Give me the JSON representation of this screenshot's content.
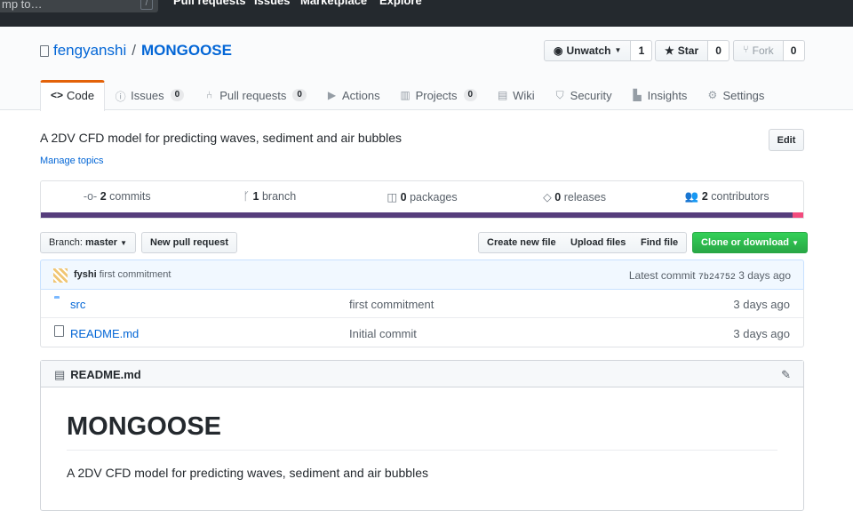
{
  "header": {
    "search_placeholder": "Search or jump to…",
    "search_visible": "mp to…",
    "slash_hint": "/",
    "nav": [
      "Pull requests",
      "Issues",
      "Marketplace",
      "Explore"
    ]
  },
  "repo": {
    "owner": "fengyanshi",
    "separator": "/",
    "name": "MONGOOSE",
    "watch_label": "Unwatch",
    "watch_count": "1",
    "star_label": "Star",
    "star_count": "0",
    "fork_label": "Fork",
    "fork_count": "0"
  },
  "tabs": [
    {
      "label": "Code",
      "icon": "code-icon"
    },
    {
      "label": "Issues",
      "count": "0",
      "icon": "issue-icon"
    },
    {
      "label": "Pull requests",
      "count": "0",
      "icon": "pull-request-icon"
    },
    {
      "label": "Actions",
      "icon": "play-icon"
    },
    {
      "label": "Projects",
      "count": "0",
      "icon": "project-icon"
    },
    {
      "label": "Wiki",
      "icon": "book-icon"
    },
    {
      "label": "Security",
      "icon": "shield-icon"
    },
    {
      "label": "Insights",
      "icon": "graph-icon"
    },
    {
      "label": "Settings",
      "icon": "gear-icon"
    }
  ],
  "description": "A 2DV CFD model for predicting waves, sediment and air bubbles",
  "manage_topics": "Manage topics",
  "edit_label": "Edit",
  "summary": {
    "commits_num": "2",
    "commits_label": "commits",
    "branch_num": "1",
    "branch_label": "branch",
    "packages_num": "0",
    "packages_label": "packages",
    "releases_num": "0",
    "releases_label": "releases",
    "contributors_num": "2",
    "contributors_label": "contributors"
  },
  "language_colors": {
    "primary": "#563d7c",
    "secondary": "#f34b7d"
  },
  "language_share": {
    "primary": 0.986,
    "secondary": 0.014
  },
  "file_nav": {
    "branch_prefix": "Branch:",
    "branch_name": "master",
    "new_pr": "New pull request",
    "create_file": "Create new file",
    "upload_files": "Upload files",
    "find_file": "Find file",
    "clone": "Clone or download"
  },
  "latest_commit": {
    "author": "fyshi",
    "message": "first commitment",
    "latest_label": "Latest commit",
    "sha": "7b24752",
    "age": "3 days ago"
  },
  "files": [
    {
      "name": "src",
      "type": "folder",
      "message": "first commitment",
      "age": "3 days ago"
    },
    {
      "name": "README.md",
      "type": "file",
      "message": "Initial commit",
      "age": "3 days ago"
    }
  ],
  "readme": {
    "file_label": "README.md",
    "heading": "MONGOOSE",
    "body": "A 2DV CFD model for predicting waves, sediment and air bubbles"
  }
}
